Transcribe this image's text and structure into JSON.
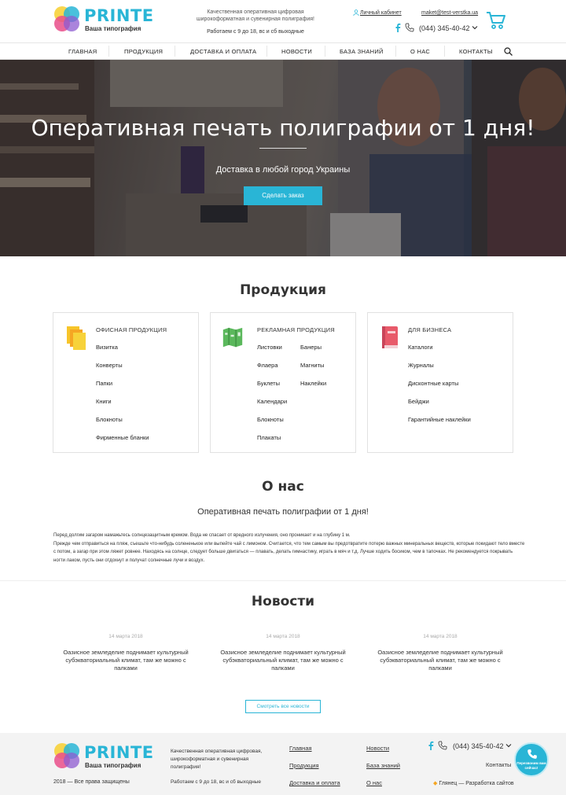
{
  "brand": {
    "name": "PRINTE",
    "subtitle": "Ваша типография",
    "accent_color": "#29b5d6"
  },
  "header": {
    "tagline": "Качественная оперативная цифровая широкоформатная и сувенирная полиграфия!",
    "hours": "Работаем с 9 до 18, вс и сб выходные",
    "cabinet_label": "Личный кабинет",
    "email": "maket@test-verstka.ua",
    "phone": "(044) 345-40-42",
    "icons": [
      "user-icon",
      "facebook-icon",
      "phone-icon",
      "chevron-down-icon",
      "cart-icon"
    ]
  },
  "nav": {
    "items": [
      "Главная",
      "Продукция",
      "Доставка и оплата",
      "Новости",
      "База знаний",
      "О нас",
      "Контакты"
    ],
    "search_icon": "search-icon"
  },
  "hero": {
    "title": "Оперативная печать полиграфии от 1 дня!",
    "subtitle": "Доставка в любой город Украины",
    "button": "Сделать заказ"
  },
  "products": {
    "title": "Продукция",
    "cards": [
      {
        "title": "Офисная продукция",
        "icon": "stack-icon",
        "col1": [
          "Визитка",
          "Конверты",
          "Папки",
          "Книги",
          "Блокноты",
          "Фирменные бланки"
        ],
        "col2": []
      },
      {
        "title": "Рекламная продукция",
        "icon": "map-icon",
        "col1": [
          "Листовки",
          "Флаера",
          "Буклеты",
          "Календари",
          "Блокноты",
          "Плакаты"
        ],
        "col2": [
          "Банеры",
          "Магниты",
          "Наклейки"
        ]
      },
      {
        "title": "Для бизнеса",
        "icon": "book-icon",
        "col1": [
          "Каталоги",
          "Журналы",
          "Дисконтные карты",
          "Бейджи",
          "Гарантийные наклейки"
        ],
        "col2": []
      }
    ]
  },
  "about": {
    "title": "О нас",
    "subtitle": "Оперативная печать полиграфии от 1 дня!",
    "paragraphs": [
      "Перед долгим загаром намажьтесь солнцезащитным кремом. Вода не спасает от вредного излучения, оно проникает и на глубину 1 м.",
      "Прежде чем отправиться на пляж, съешьте что-нибудь солененькое или выпейте чай с лимоном. Считается, что тем самым вы предотвратите потерю важных минеральных веществ, которые покидают тело вместе с потом, а загар при этом ляжет ровнее. Находясь на солнце, следует больше двигаться — плавать, делать гимнастику, играть в мяч и т.д. Лучше ходить босиком, чем в тапочках. Не рекомендуется покрывать ногти лаком, пусть они отдохнут и получат солнечные лучи и воздух."
    ]
  },
  "news": {
    "title": "Новости",
    "items": [
      {
        "date": "14 марта 2018",
        "text": "Оазисное земледелие поднимает культурный субэкваториальный климат, там же можно с палками"
      },
      {
        "date": "14 марта 2018",
        "text": "Оазисное земледелие поднимает культурный субэкваториальный климат, там же можно с палками"
      },
      {
        "date": "14 марта 2018",
        "text": "Оазисное земледелие поднимает культурный субэкваториальный климат, там же можно с палками"
      }
    ],
    "all_button": "Смотреть все новости"
  },
  "footer": {
    "tagline": "Качественная оперативная цифровая, широкоформатная и сувенирная полиграфия!",
    "copyright": "2018 — Все права защищены",
    "hours": "Работаем с 9 до 18, вс и сб выходные",
    "links_col1": [
      "Главная",
      "Продукция",
      "Доставка и оплата"
    ],
    "links_col2": [
      "Новости",
      "База знаний",
      "О нас"
    ],
    "phone": "(044) 345-40-42",
    "contacts": "Контакты",
    "developer": "Глянец — Разработка сайтов",
    "callback": "Перезвоним вам сейчас!"
  }
}
